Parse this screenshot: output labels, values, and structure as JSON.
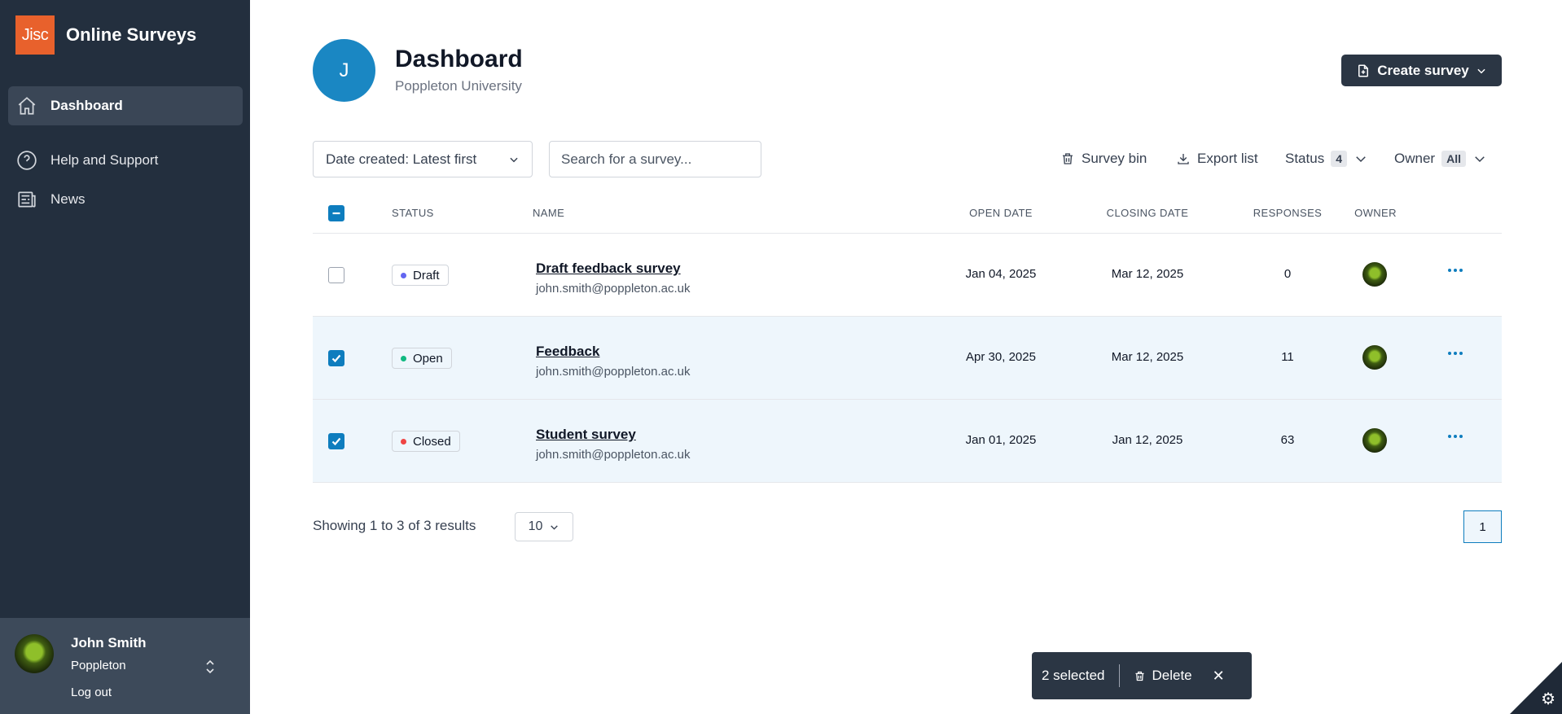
{
  "app": {
    "logo_text": "Jisc",
    "title": "Online Surveys"
  },
  "sidebar": {
    "items": [
      {
        "label": "Dashboard",
        "icon": "home-icon",
        "active": true
      },
      {
        "label": "Help and Support",
        "icon": "help-circle-icon"
      },
      {
        "label": "News",
        "icon": "newspaper-icon"
      }
    ]
  },
  "user": {
    "name": "John Smith",
    "org": "Poppleton",
    "logout": "Log out"
  },
  "header": {
    "avatar_letter": "J",
    "title": "Dashboard",
    "subtitle": "Poppleton University",
    "create_label": "Create survey"
  },
  "toolbar": {
    "sort_label": "Date created: Latest first",
    "search_placeholder": "Search for a survey...",
    "bin_label": "Survey bin",
    "export_label": "Export list",
    "status_label": "Status",
    "status_count": "4",
    "owner_label": "Owner",
    "owner_value": "All"
  },
  "table": {
    "headers": {
      "status": "STATUS",
      "name": "NAME",
      "open": "OPEN DATE",
      "closing": "CLOSING DATE",
      "responses": "RESPONSES",
      "owner": "OWNER"
    },
    "rows": [
      {
        "status": "Draft",
        "status_color": "#6366f1",
        "name": "Draft feedback survey",
        "email": "john.smith@poppleton.ac.uk",
        "open": "Jan 04, 2025",
        "closing": "Mar 12, 2025",
        "responses": "0",
        "selected": false
      },
      {
        "status": "Open",
        "status_color": "#10b981",
        "name": "Feedback",
        "email": "john.smith@poppleton.ac.uk",
        "open": "Apr 30, 2025",
        "closing": "Mar 12, 2025",
        "responses": "11",
        "selected": true
      },
      {
        "status": "Closed",
        "status_color": "#ef4444",
        "name": "Student survey",
        "email": "john.smith@poppleton.ac.uk",
        "open": "Jan 01, 2025",
        "closing": "Jan 12, 2025",
        "responses": "63",
        "selected": true
      }
    ]
  },
  "pagination": {
    "showing": "Showing 1 to 3 of 3 results",
    "per_page": "10",
    "current_page": "1"
  },
  "selection_bar": {
    "count_label": "2 selected",
    "delete_label": "Delete",
    "close_glyph": "✕"
  },
  "colors": {
    "sidebar": "#232f3e",
    "accent": "#0e7dbe",
    "brand": "#e8612c"
  }
}
